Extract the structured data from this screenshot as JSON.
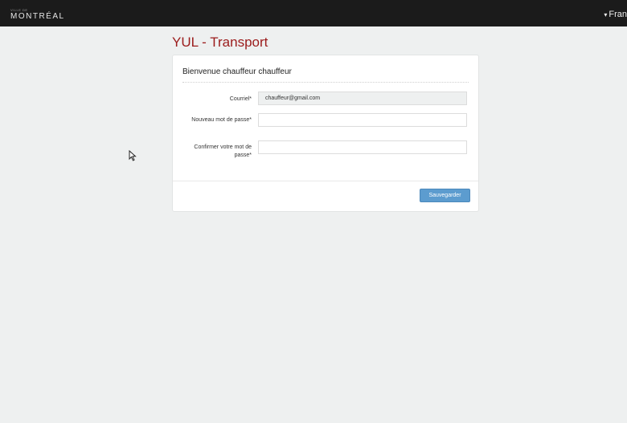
{
  "header": {
    "logo_tagline": "VILLE DE",
    "logo_text": "MONTRÉAL",
    "language_menu": "Fran"
  },
  "page": {
    "title": "YUL - Transport"
  },
  "form": {
    "heading": "Bienvenue chauffeur chauffeur",
    "email_label": "Courriel*",
    "email_value": "chauffeur@gmail.com",
    "new_password_label": "Nouveau mot de passe*",
    "new_password_value": "",
    "confirm_password_label": "Confirmer votre mot de passe*",
    "confirm_password_value": "",
    "save_label": "Sauvegarder"
  },
  "icons": {
    "language_caret": "chevron-down-icon",
    "pointer": "mouse-cursor-icon"
  },
  "colors": {
    "topbar": "#1b1b1b",
    "title": "#9b1b1b",
    "save_button": "#5c9ccf",
    "background": "#eef0f0"
  }
}
